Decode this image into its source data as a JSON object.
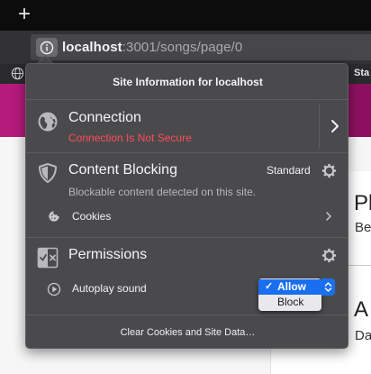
{
  "tabs": {
    "new_tab_symbol": "+"
  },
  "urlbar": {
    "host": "localhost",
    "rest": ":3001/songs/page/0"
  },
  "bookmarks": {
    "trailing_stub": "Sta"
  },
  "page": {
    "card_title": "Pl",
    "card_sub": "Be",
    "card_title2": "A",
    "card_sub2": "Da",
    "band_color": "#8d1060"
  },
  "panel": {
    "header": "Site Information for localhost",
    "connection": {
      "title": "Connection",
      "status": "Connection Is Not Secure",
      "status_color": "#ff4b5a"
    },
    "content_blocking": {
      "title": "Content Blocking",
      "level": "Standard",
      "description": "Blockable content detected on this site.",
      "cookies_label": "Cookies"
    },
    "permissions": {
      "title": "Permissions",
      "autoplay_label": "Autoplay sound",
      "options": [
        "Allow",
        "Block"
      ],
      "selected": "Allow",
      "check_mark": "✓"
    },
    "footer": "Clear Cookies and Site Data…"
  },
  "icons": {
    "info": "info-icon",
    "globe": "globe-icon",
    "shield": "shield-icon",
    "gear": "gear-icon",
    "chevron": "chevron-right-icon",
    "cookie": "cookie-icon",
    "permissions": "permissions-icon",
    "autoplay": "autoplay-icon",
    "stepper": "select-stepper-icon"
  },
  "colors": {
    "panel_bg": "#4a4a4d",
    "accent": "#1a6ff0"
  }
}
